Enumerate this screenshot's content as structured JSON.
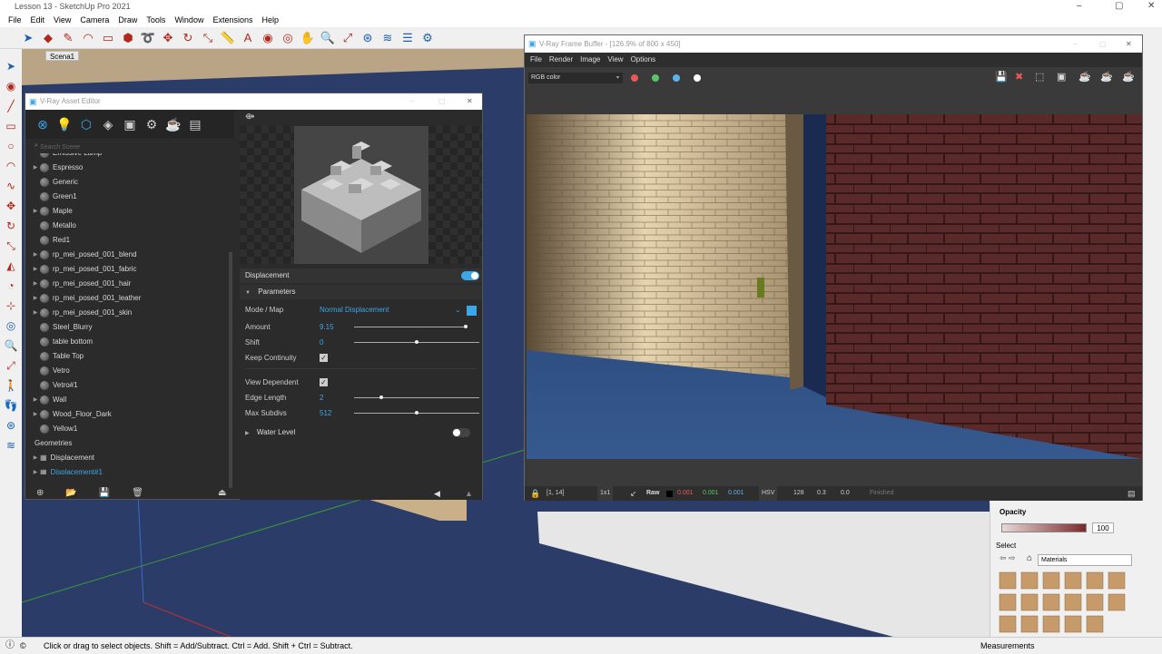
{
  "sketchup": {
    "title": "Lesson 13 - SketchUp Pro 2021",
    "menu": [
      "File",
      "Edit",
      "View",
      "Camera",
      "Draw",
      "Tools",
      "Window",
      "Extensions",
      "Help"
    ],
    "scene_tab": "Scena1",
    "status_text": "Click or drag to select objects. Shift = Add/Subtract. Ctrl = Add. Shift + Ctrl = Subtract.",
    "measurements_label": "Measurements",
    "opacity_label": "Opacity",
    "opacity_value": "100",
    "select_label": "Select",
    "materials_dropdown": "Materials"
  },
  "asset_editor": {
    "title": "V-Ray Asset Editor",
    "search_placeholder": "Search Scene",
    "materials": [
      {
        "label": "Emissive Lamp",
        "expandable": false
      },
      {
        "label": "Espresso",
        "expandable": true
      },
      {
        "label": "Generic",
        "expandable": false
      },
      {
        "label": "Green1",
        "expandable": false
      },
      {
        "label": "Maple",
        "expandable": true
      },
      {
        "label": "Metallo",
        "expandable": false
      },
      {
        "label": "Red1",
        "expandable": false
      },
      {
        "label": "rp_mei_posed_001_blend",
        "expandable": true
      },
      {
        "label": "rp_mei_posed_001_fabric",
        "expandable": true
      },
      {
        "label": "rp_mei_posed_001_hair",
        "expandable": true
      },
      {
        "label": "rp_mei_posed_001_leather",
        "expandable": true
      },
      {
        "label": "rp_mei_posed_001_skin",
        "expandable": true
      },
      {
        "label": "Steel_Blurry",
        "expandable": false
      },
      {
        "label": "table bottom",
        "expandable": false
      },
      {
        "label": "Table Top",
        "expandable": false
      },
      {
        "label": "Vetro",
        "expandable": false
      },
      {
        "label": "Vetro#1",
        "expandable": false
      },
      {
        "label": "Wall",
        "expandable": true
      },
      {
        "label": "Wood_Floor_Dark",
        "expandable": true
      },
      {
        "label": "Yellow1",
        "expandable": false
      }
    ],
    "geometries_header": "Geometries",
    "geometries": [
      "Displacement",
      "Displacement#1"
    ],
    "displacement": {
      "header": "Displacement",
      "enabled": true,
      "parameters_header": "Parameters",
      "mode_label": "Mode / Map",
      "mode_value": "Normal Displacement",
      "amount_label": "Amount",
      "amount_value": "9.15",
      "amount_fraction": 0.98,
      "shift_label": "Shift",
      "shift_value": "0",
      "shift_fraction": 0.5,
      "keep_continuity_label": "Keep Continuity",
      "keep_continuity": true,
      "view_dependent_label": "View Dependent",
      "view_dependent": true,
      "edge_length_label": "Edge Length",
      "edge_length_value": "2",
      "edge_length_fraction": 0.22,
      "max_subdivs_label": "Max Subdivs",
      "max_subdivs_value": "512",
      "max_subdivs_fraction": 0.5,
      "water_level_label": "Water Level",
      "water_level_enabled": false
    }
  },
  "vfb": {
    "title": "V-Ray Frame Buffer - [126.9% of 800 x 450]",
    "menu": [
      "File",
      "Render",
      "Image",
      "View",
      "Options"
    ],
    "channel": "RGB color",
    "coords": "[1, 14]",
    "zoom": "1x1",
    "raw_label": "Raw",
    "r": "0.001",
    "g": "0.001",
    "b": "0.001",
    "color_mode": "HSV",
    "h": "128",
    "s": "0.3",
    "v": "0.0",
    "status": "Finished"
  },
  "colors": {
    "accent": "#3ba6e8",
    "red_channel": "#e85a5a",
    "green_channel": "#55c765",
    "blue_channel": "#5ab4e8"
  }
}
